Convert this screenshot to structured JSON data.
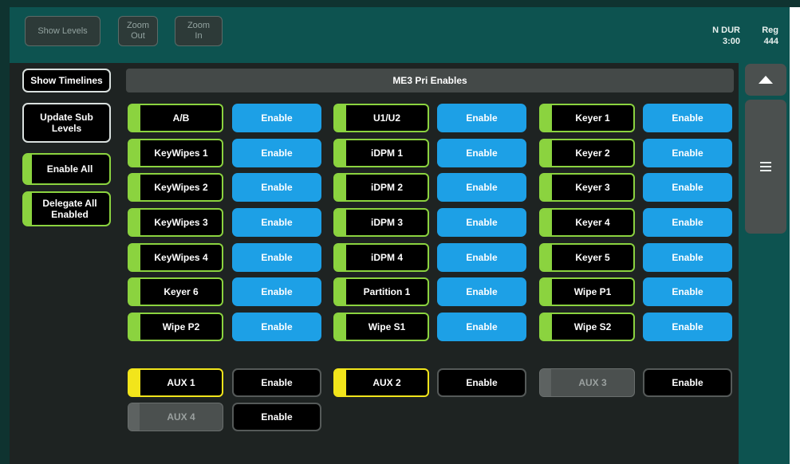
{
  "toolbar": {
    "show_levels": "Show Levels",
    "zoom_out": [
      "Zoom",
      "Out"
    ],
    "zoom_in": [
      "Zoom",
      "In"
    ]
  },
  "status": {
    "ndur_label": "N DUR",
    "ndur_value": "3:00",
    "reg_label": "Reg",
    "reg_value": "444"
  },
  "sidebar": {
    "show_timelines": "Show Timelines",
    "update_sub_levels": [
      "Update Sub",
      "Levels"
    ],
    "enable_all": "Enable All",
    "delegate_all_enabled": [
      "Delegate All",
      "Enabled"
    ]
  },
  "panel_title": "ME3 Pri Enables",
  "enable_label": "Enable",
  "columns": [
    [
      "A/B",
      "KeyWipes 1",
      "KeyWipes 2",
      "KeyWipes 3",
      "KeyWipes 4",
      "Keyer 6",
      "Wipe P2"
    ],
    [
      "U1/U2",
      "iDPM 1",
      "iDPM 2",
      "iDPM 3",
      "iDPM 4",
      "Partition 1",
      "Wipe S1"
    ],
    [
      "Keyer 1",
      "Keyer 2",
      "Keyer 3",
      "Keyer 4",
      "Keyer 5",
      "Wipe P1",
      "Wipe S2"
    ]
  ],
  "aux": [
    {
      "label": "AUX 1",
      "state": "on"
    },
    {
      "label": "AUX 2",
      "state": "on"
    },
    {
      "label": "AUX 3",
      "state": "off"
    },
    {
      "label": "AUX 4",
      "state": "off"
    }
  ],
  "colors": {
    "enabled_green": "#8bd33f",
    "enable_blue": "#1da0e6",
    "aux_yellow": "#f2e51b",
    "bar_teal": "#0d5350"
  },
  "icons": {
    "scroll_up": "triangle-up-icon",
    "scroll_thumb": "hamburger-icon"
  }
}
